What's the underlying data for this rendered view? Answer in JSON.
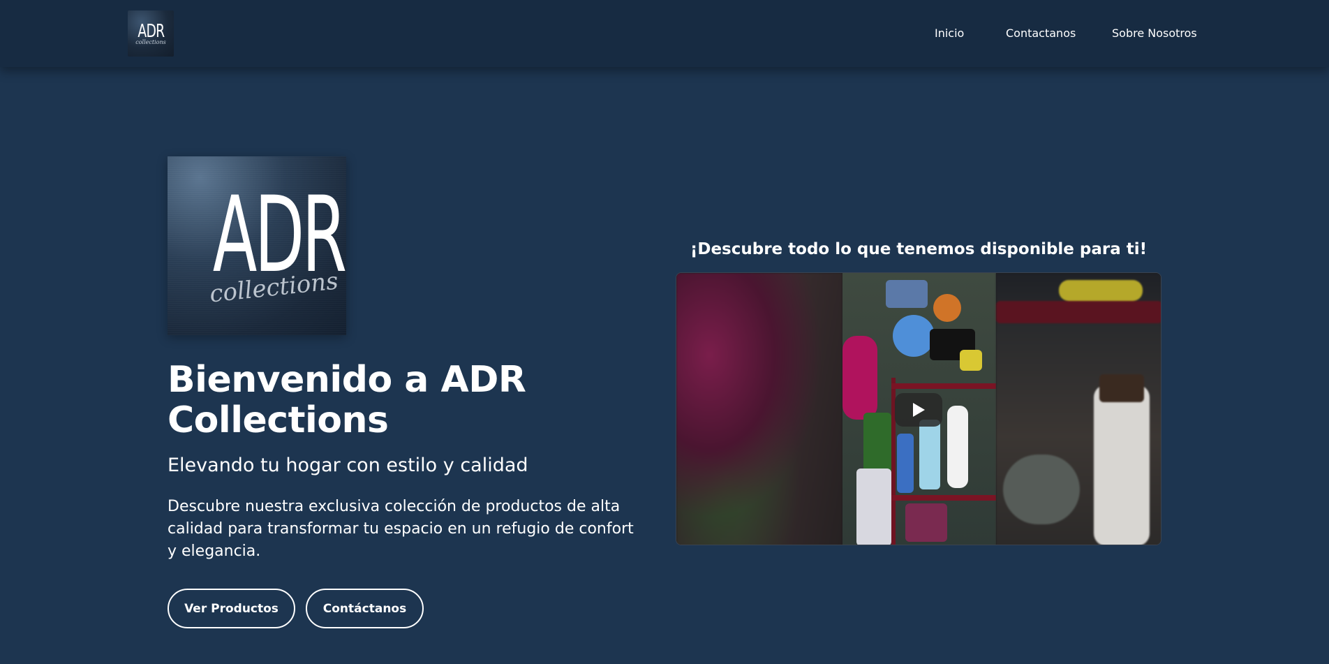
{
  "nav": {
    "logo_text": "ADR",
    "logo_script": "collections",
    "links": [
      "Inicio",
      "Contactanos",
      "Sobre Nosotros"
    ]
  },
  "hero": {
    "logo_text": "ADR",
    "logo_script": "collections",
    "title": "Bienvenido a ADR Collections",
    "subtitle": "Elevando tu hogar con estilo y calidad",
    "description": "Descubre nuestra exclusiva colección de productos de alta calidad para transformar tu espacio en un refugio de confort y elegancia.",
    "buttons": {
      "products": "Ver Productos",
      "contact": "Contáctanos"
    }
  },
  "video": {
    "heading": "¡Descubre todo lo que tenemos disponible para ti!",
    "play_icon": "play-icon"
  },
  "colors": {
    "background": "#1d3550",
    "navbar": "#172b42",
    "text": "#ffffff"
  }
}
